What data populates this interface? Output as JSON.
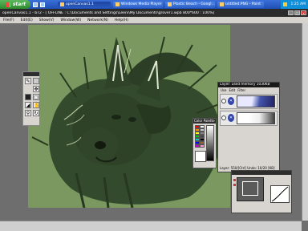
{
  "taskbar": {
    "start_label": "start",
    "tasks": [
      {
        "label": "openCanvas1.1",
        "active": true
      },
      {
        "label": "Windows Media Player",
        "active": false
      },
      {
        "label": "Plastic Beach - Googl...",
        "active": false
      },
      {
        "label": "untitled.PNG - Paint",
        "active": false
      }
    ],
    "clock": "1:25 AM"
  },
  "app": {
    "title": "openCanvas1.1 - b72 - [ OFFLINE : C:\\Documents and Settings\\Leeni\\My Documents\\grover1.wpb 800*600 : 100%]",
    "menu": [
      "File(F)",
      "Edit(E)",
      "Show(V)",
      "Window(W)",
      "Network(N)",
      "Help(H)"
    ]
  },
  "color_palette": {
    "title": "Color Palette",
    "swatches": [
      "#ff0000",
      "#ffffff",
      "#ff8800",
      "#cccccc",
      "#ffff00",
      "#888888",
      "#00cc00",
      "#444444",
      "#00cccc",
      "#000000",
      "#0000ff",
      "#996633",
      "#cc00cc",
      "#ff99cc"
    ]
  },
  "layers": {
    "title": "Layer: used memory 1030KB",
    "toolbar": [
      "Use",
      "Edit",
      "Filter"
    ],
    "status": "Layer: 550/[Ctrl] Undo: 10/20 [KB]"
  }
}
